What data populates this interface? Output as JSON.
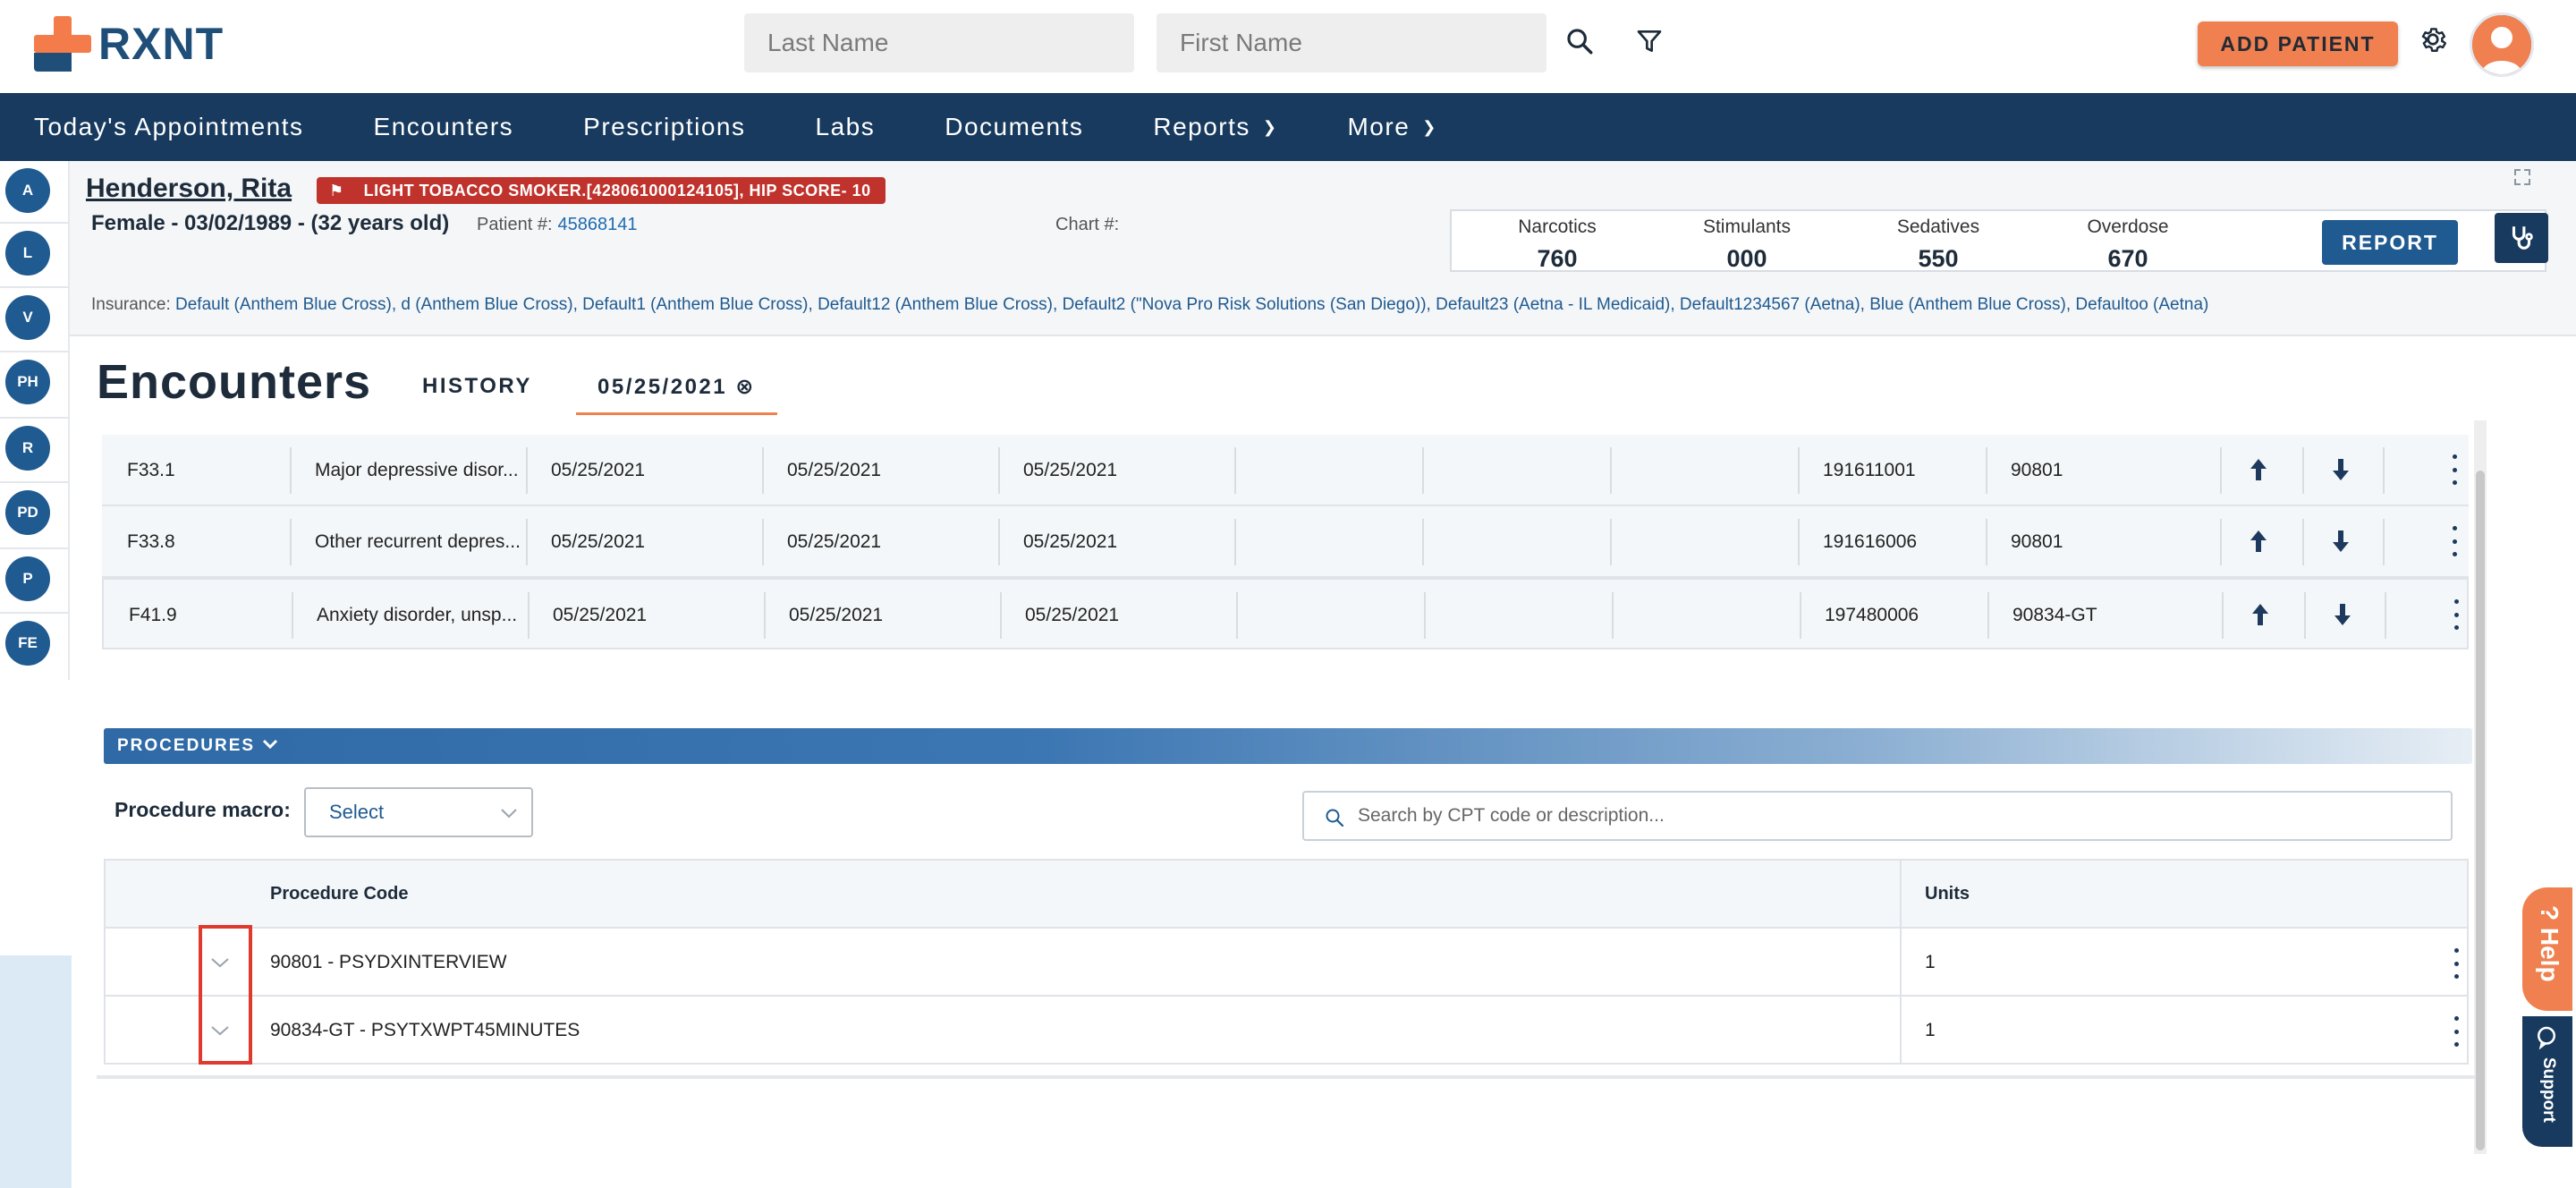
{
  "header": {
    "logo_text": "RXNT",
    "last_name_placeholder": "Last Name",
    "first_name_placeholder": "First Name",
    "add_patient_label": "ADD PATIENT"
  },
  "nav": {
    "items": [
      "Today's Appointments",
      "Encounters",
      "Prescriptions",
      "Labs",
      "Documents",
      "Reports",
      "More"
    ]
  },
  "rail": {
    "buttons": [
      "A",
      "L",
      "V",
      "PH",
      "R",
      "PD",
      "P",
      "FE"
    ]
  },
  "patient": {
    "name": "Henderson, Rita",
    "flag": "LIGHT TOBACCO SMOKER.[428061000124105], HIP SCORE- 10",
    "demographics": "Female - 03/02/1989 - (32 years old)",
    "patient_num_label": "Patient #:",
    "patient_num": "45868141",
    "chart_label": "Chart #:",
    "insurance_label": "Insurance:",
    "insurance": "Default (Anthem Blue Cross), d (Anthem Blue Cross), Default1 (Anthem Blue Cross), Default12 (Anthem Blue Cross), Default2 (\"Nova Pro Risk Solutions (San Diego)), Default23 (Aetna - IL Medicaid), Default1234567 (Aetna), Blue (Anthem Blue Cross), Defaultoo (Aetna)"
  },
  "rx_stats": {
    "narcotics_label": "Narcotics",
    "narcotics": "760",
    "stimulants_label": "Stimulants",
    "stimulants": "000",
    "sedatives_label": "Sedatives",
    "sedatives": "550",
    "overdose_label": "Overdose",
    "overdose": "670",
    "report_label": "REPORT"
  },
  "encounters": {
    "title": "Encounters",
    "tab_history": "HISTORY",
    "tab_date": "05/25/2021 ⊗"
  },
  "diagnoses": [
    {
      "code": "F33.1",
      "desc": "Major depressive disor...",
      "d1": "05/25/2021",
      "d2": "05/25/2021",
      "d3": "05/25/2021",
      "snomed": "191611001",
      "cpt": "90801"
    },
    {
      "code": "F33.8",
      "desc": "Other recurrent depres...",
      "d1": "05/25/2021",
      "d2": "05/25/2021",
      "d3": "05/25/2021",
      "snomed": "191616006",
      "cpt": "90801"
    },
    {
      "code": "F41.9",
      "desc": "Anxiety disorder, unsp...",
      "d1": "05/25/2021",
      "d2": "05/25/2021",
      "d3": "05/25/2021",
      "snomed": "197480006",
      "cpt": "90834-GT"
    }
  ],
  "procedures": {
    "section_label": "PROCEDURES",
    "macro_label": "Procedure macro:",
    "macro_value": "Select",
    "search_placeholder": "Search by CPT code or description...",
    "col_code": "Procedure Code",
    "col_units": "Units",
    "rows": [
      {
        "code": "90801 - PSYDXINTERVIEW",
        "units": "1"
      },
      {
        "code": "90834-GT - PSYTXWPT45MINUTES",
        "units": "1"
      }
    ]
  },
  "side_tabs": {
    "help": "? Help",
    "support": "Support"
  },
  "colors": {
    "brand_navy": "#173a5e",
    "accent_orange": "#f08050",
    "flag_red": "#c0322c",
    "highlight_red": "#e0392d"
  }
}
